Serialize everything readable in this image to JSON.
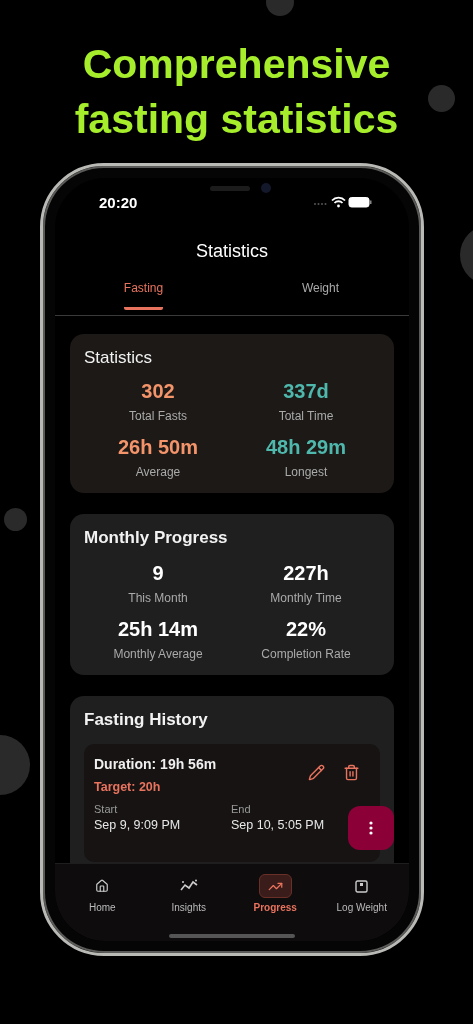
{
  "headline": "Comprehensive fasting statistics",
  "status_bar": {
    "time": "20:20"
  },
  "screen_title": "Statistics",
  "tabs": [
    {
      "label": "Fasting",
      "selected": true
    },
    {
      "label": "Weight",
      "selected": false
    }
  ],
  "cards": [
    {
      "kind": "summary",
      "title": "Statistics",
      "stats": [
        {
          "value": "302",
          "label": "Total Fasts",
          "color": "#f4946a"
        },
        {
          "value": "337d",
          "label": "Total Time",
          "color": "#4fb8ad"
        },
        {
          "value": "26h 50m",
          "label": "Average",
          "color": "#f4946a"
        },
        {
          "value": "48h 29m",
          "label": "Longest",
          "color": "#4fb8ad"
        }
      ]
    },
    {
      "kind": "monthly",
      "title": "Monthly Progress",
      "stats": [
        {
          "value": "9",
          "label": "This Month"
        },
        {
          "value": "227h",
          "label": "Monthly Time"
        },
        {
          "value": "25h 14m",
          "label": "Monthly Average"
        },
        {
          "value": "22%",
          "label": "Completion Rate"
        }
      ]
    },
    {
      "kind": "history",
      "title": "Fasting History",
      "entries": [
        {
          "duration": "Duration: 19h 56m",
          "target": "Target: 20h",
          "start_label": "Start",
          "start": "Sep 9, 9:09 PM",
          "end_label": "End",
          "end": "Sep 10, 5:05 PM"
        }
      ]
    }
  ],
  "bottom_nav": [
    {
      "label": "Home",
      "selected": false
    },
    {
      "label": "Insights",
      "selected": false
    },
    {
      "label": "Progress",
      "selected": true
    },
    {
      "label": "Log Weight",
      "selected": false
    }
  ]
}
